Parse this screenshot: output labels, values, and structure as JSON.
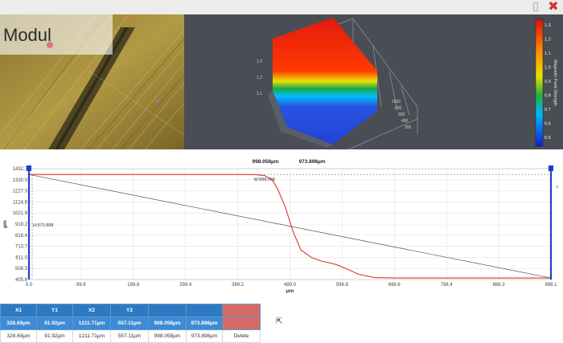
{
  "window": {
    "title": "Modul"
  },
  "icons": {
    "document": "document-icon",
    "close": "close-icon"
  },
  "colorbar": {
    "title": "Magnetic Field Strength",
    "ticks": [
      "1.3",
      "1.2",
      "1.1",
      "1.0",
      "0.9",
      "0.8",
      "0.7",
      "0.6",
      "0.5"
    ]
  },
  "chart_data": {
    "type": "line",
    "xlabel": "µm",
    "ylabel": "µm",
    "xlim": [
      0.0,
      998.1
    ],
    "ylim": [
      405.6,
      1432.7
    ],
    "x_ticks": [
      "0.0",
      "99.8",
      "199.6",
      "299.4",
      "399.2",
      "499.0",
      "598.8",
      "698.6",
      "798.4",
      "898.3",
      "998.1"
    ],
    "y_ticks": [
      "1432.7",
      "1330.0",
      "1227.3",
      "1124.6",
      "1021.9",
      "919.2",
      "816.4",
      "713.7",
      "611.0",
      "508.3",
      "405.6"
    ],
    "header_labels": [
      "998.058µm",
      "973.898µm"
    ],
    "annotations": [
      "H:973.898",
      "W:998.058"
    ],
    "series": [
      {
        "color": "#d93a2b",
        "x": [
          0,
          100,
          200,
          300,
          399,
          430,
          450,
          465,
          475,
          490,
          505,
          520,
          540,
          560,
          575,
          590,
          610,
          630,
          660,
          700,
          800,
          900,
          998
        ],
        "y": [
          1379,
          1379,
          1379,
          1379,
          1379,
          1378,
          1370,
          1330,
          1250,
          1080,
          850,
          680,
          610,
          575,
          560,
          540,
          500,
          455,
          425,
          420,
          420,
          420,
          420
        ]
      },
      {
        "color": "#555555",
        "x": [
          0,
          998.1
        ],
        "y": [
          1379,
          420
        ]
      }
    ],
    "grid": true
  },
  "table": {
    "headers": [
      "X1",
      "Y1",
      "X2",
      "Y2",
      "",
      "",
      ""
    ],
    "header_values": [
      "328.69µm",
      "91.92µm",
      "1211.71µm",
      "557.11µm",
      "998.058µm",
      "973.898µm",
      ""
    ],
    "row": [
      "328.69µm",
      "91.92µm",
      "1211.71µm",
      "557.11µm",
      "998.058µm",
      "973.898µm"
    ],
    "delete_label": "Delete"
  }
}
